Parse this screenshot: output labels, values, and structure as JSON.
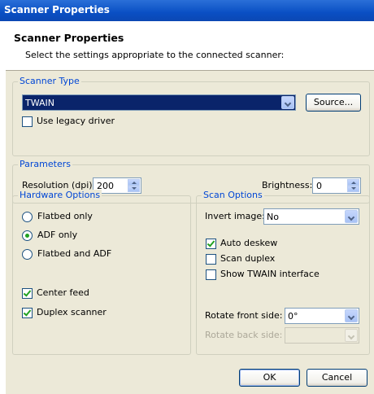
{
  "window": {
    "title": "Scanner Properties"
  },
  "header": {
    "title": "Scanner Properties",
    "subtitle": "Select the settings appropriate to the connected scanner:"
  },
  "scanner_type": {
    "legend": "Scanner Type",
    "selected": "TWAIN",
    "source_button": "Source...",
    "legacy_label": "Use legacy driver",
    "legacy_checked": false
  },
  "parameters": {
    "legend": "Parameters",
    "resolution_label": "Resolution (dpi):",
    "resolution_value": "200",
    "brightness_label": "Brightness:",
    "brightness_value": "0"
  },
  "hardware": {
    "legend": "Hardware Options",
    "radios": [
      {
        "label": "Flatbed only",
        "selected": false
      },
      {
        "label": "ADF only",
        "selected": true
      },
      {
        "label": "Flatbed and ADF",
        "selected": false
      }
    ],
    "center_feed_label": "Center feed",
    "center_feed_checked": true,
    "duplex_label": "Duplex scanner",
    "duplex_checked": true
  },
  "scan_options": {
    "legend": "Scan Options",
    "invert_label": "Invert image:",
    "invert_value": "No",
    "auto_deskew_label": "Auto deskew",
    "auto_deskew_checked": true,
    "scan_duplex_label": "Scan duplex",
    "scan_duplex_checked": false,
    "show_twain_label": "Show TWAIN interface",
    "show_twain_checked": false,
    "rotate_front_label": "Rotate front side:",
    "rotate_front_value": "0°",
    "rotate_back_label": "Rotate back side:",
    "rotate_back_value": ""
  },
  "buttons": {
    "ok": "OK",
    "cancel": "Cancel"
  }
}
